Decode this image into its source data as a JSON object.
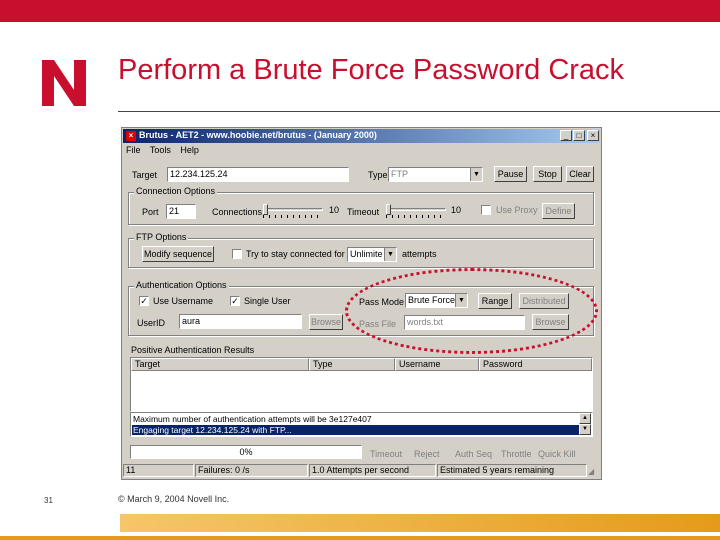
{
  "slide": {
    "title": "Perform a Brute Force Password Crack",
    "page_number": "31",
    "copyright": "© March 9, 2004 Novell Inc.",
    "accent_color": "#c8102e",
    "bottom_color": "#e69a1a"
  },
  "window": {
    "title": "Brutus - AET2 - www.hoobie.net/brutus - (January 2000)",
    "min_label": "_",
    "max_label": "□",
    "close_label": "×",
    "menu": [
      "File",
      "Tools",
      "Help"
    ]
  },
  "target": {
    "label": "Target",
    "value": "12.234.125.24",
    "type_label": "Type",
    "type_value": "FTP",
    "start_label": "Pause",
    "stop_label": "Stop",
    "clear_label": "Clear"
  },
  "connection": {
    "group_title": "Connection Options",
    "port_label": "Port",
    "port_value": "21",
    "connections_label": "Connections",
    "connections_value": "10",
    "timeout_label": "Timeout",
    "timeout_value": "10",
    "use_proxy_label": "Use Proxy",
    "define_label": "Define"
  },
  "ftp": {
    "group_title": "FTP Options",
    "modify_sequence_label": "Modify sequence",
    "try_stay_label": "Try to stay connected for",
    "stay_value": "Unlimite",
    "attempts_label": "attempts"
  },
  "auth": {
    "group_title": "Authentication Options",
    "use_username_label": "Use Username",
    "single_user_label": "Single User",
    "userid_label": "UserID",
    "userid_value": "aura",
    "browse1_label": "Browse",
    "pass_mode_label": "Pass Mode",
    "pass_mode_value": "Brute Force",
    "range_label": "Range",
    "distributed_label": "Distributed",
    "pass_file_label": "Pass File",
    "pass_file_value": "words.txt",
    "browse2_label": "Browse"
  },
  "results": {
    "title": "Positive Authentication Results",
    "columns": [
      "Target",
      "Type",
      "Username",
      "Password"
    ]
  },
  "log": {
    "lines": [
      "Maximum number of authentication attempts will be 3e127e407",
      "Engaging target 12.234.125.24 with FTP..."
    ]
  },
  "status": {
    "progress_text": "0%",
    "progress_fraction": 0,
    "indicators": [
      "Timeout",
      "Reject",
      "Auth Seq",
      "Throttle",
      "Quick Kill"
    ],
    "bar": [
      "11",
      "Failures: 0 /s",
      "1.0 Attempts per second",
      "Estimated 5 years remaining"
    ]
  }
}
